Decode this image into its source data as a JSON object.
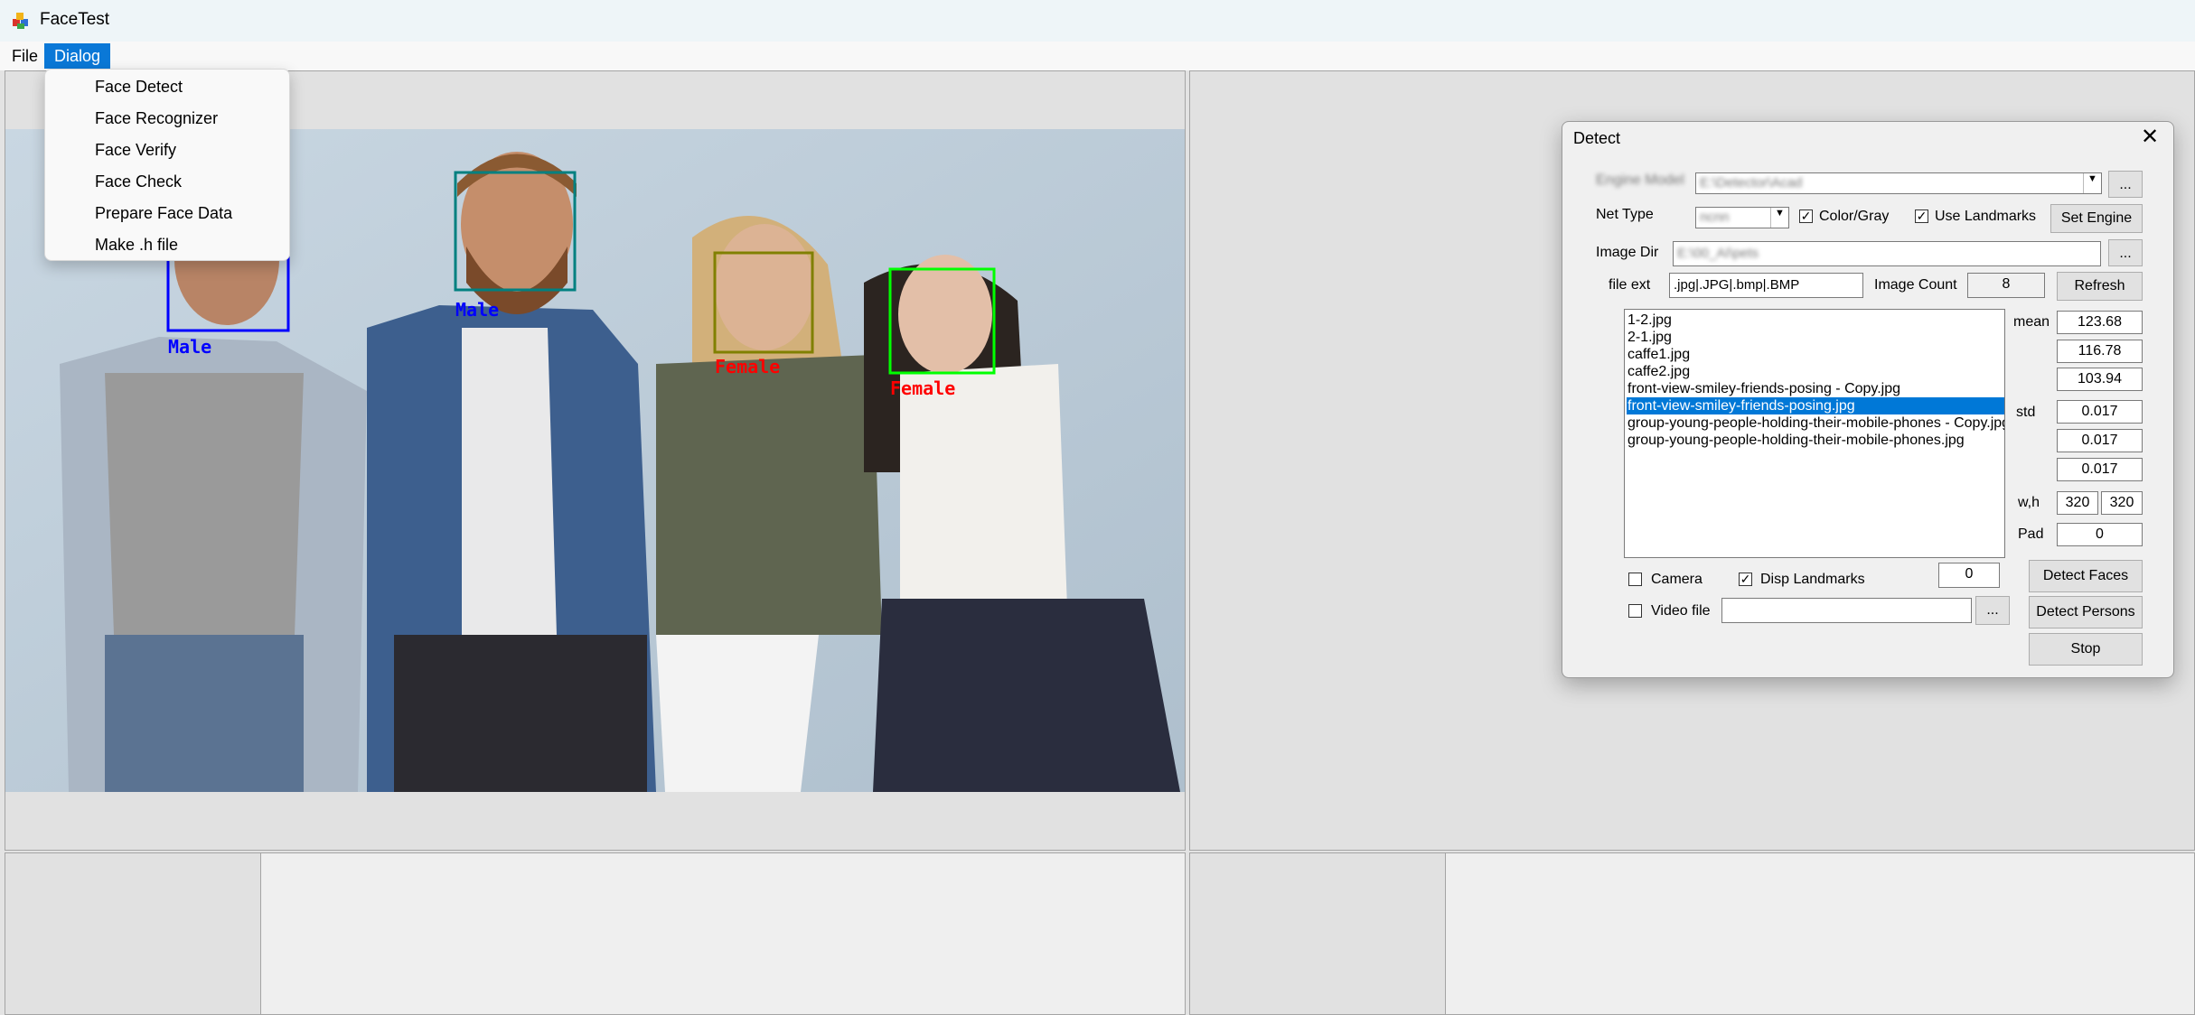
{
  "window": {
    "title": "FaceTest",
    "icon": "app-icon"
  },
  "menubar": {
    "file": "File",
    "dialog": "Dialog"
  },
  "dropdown": {
    "items": [
      "Face Detect",
      "Face Recognizer",
      "Face Verify",
      "Face Check",
      "Prepare Face Data",
      "Make .h file"
    ]
  },
  "detections": [
    {
      "label": "Male",
      "color": "#0000ff"
    },
    {
      "label": "Male",
      "color": "#008080"
    },
    {
      "label": "Female",
      "color": "#808000"
    },
    {
      "label": "Female",
      "color": "#00ff00"
    }
  ],
  "label_colors": {
    "male": "#0000ff",
    "female": "#ff0000"
  },
  "dialog": {
    "title": "Detect",
    "engine_model_label": "Engine Model",
    "engine_model_value": "E:\\Detector\\Acad",
    "browse": "...",
    "net_type_label": "Net Type",
    "net_type_value": "ncnn",
    "color_gray_label": "Color/Gray",
    "color_gray_checked": true,
    "use_landmarks_label": "Use Landmarks",
    "use_landmarks_checked": true,
    "set_engine": "Set Engine",
    "image_dir_label": "Image Dir",
    "image_dir_value": "E:\\00_AI\\pets",
    "file_ext_label": "file ext",
    "file_ext_value": ".jpg|.JPG|.bmp|.BMP",
    "image_count_label": "Image Count",
    "image_count_value": "8",
    "refresh": "Refresh",
    "files": [
      "1-2.jpg",
      "2-1.jpg",
      "caffe1.jpg",
      "caffe2.jpg",
      "front-view-smiley-friends-posing - Copy.jpg",
      "front-view-smiley-friends-posing.jpg",
      "group-young-people-holding-their-mobile-phones - Copy.jpg",
      "group-young-people-holding-their-mobile-phones.jpg"
    ],
    "selected_file": "front-view-smiley-friends-posing.jpg",
    "mean_label": "mean",
    "mean": [
      "123.68",
      "116.78",
      "103.94"
    ],
    "std_label": "std",
    "std": [
      "0.017",
      "0.017",
      "0.017"
    ],
    "wh_label": "w,h",
    "w": "320",
    "h": "320",
    "pad_label": "Pad",
    "pad": "0",
    "camera_label": "Camera",
    "camera_checked": false,
    "disp_landmarks_label": "Disp Landmarks",
    "disp_landmarks_checked": true,
    "camera_index": "0",
    "detect_faces": "Detect Faces",
    "video_file_label": "Video file",
    "video_file_checked": false,
    "video_file_value": "",
    "detect_persons": "Detect Persons",
    "stop": "Stop"
  }
}
